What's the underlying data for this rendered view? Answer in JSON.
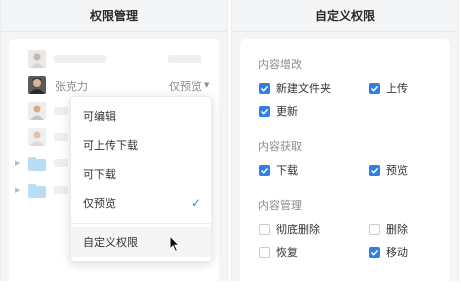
{
  "left_panel": {
    "title": "权限管理",
    "user": {
      "name": "张克力",
      "permission": "仅预览"
    },
    "menu": {
      "items": [
        {
          "label": "可编辑",
          "checked": false
        },
        {
          "label": "可上传下载",
          "checked": false
        },
        {
          "label": "可下载",
          "checked": false
        },
        {
          "label": "仅预览",
          "checked": true
        }
      ],
      "custom_label": "自定义权限"
    }
  },
  "right_panel": {
    "title": "自定义权限",
    "sections": [
      {
        "title": "内容增改",
        "options": [
          {
            "label": "新建文件夹",
            "checked": true
          },
          {
            "label": "上传",
            "checked": true
          },
          {
            "label": "更新",
            "checked": true
          }
        ]
      },
      {
        "title": "内容获取",
        "options": [
          {
            "label": "下载",
            "checked": true
          },
          {
            "label": "预览",
            "checked": true
          }
        ]
      },
      {
        "title": "内容管理",
        "options": [
          {
            "label": "彻底删除",
            "checked": false
          },
          {
            "label": "删除",
            "checked": false
          },
          {
            "label": "恢复",
            "checked": false
          },
          {
            "label": "移动",
            "checked": true
          }
        ]
      }
    ]
  },
  "colors": {
    "accent": "#2e7fe8",
    "panel_bg": "#f4f5f7",
    "folder": "#b9dcf7"
  }
}
